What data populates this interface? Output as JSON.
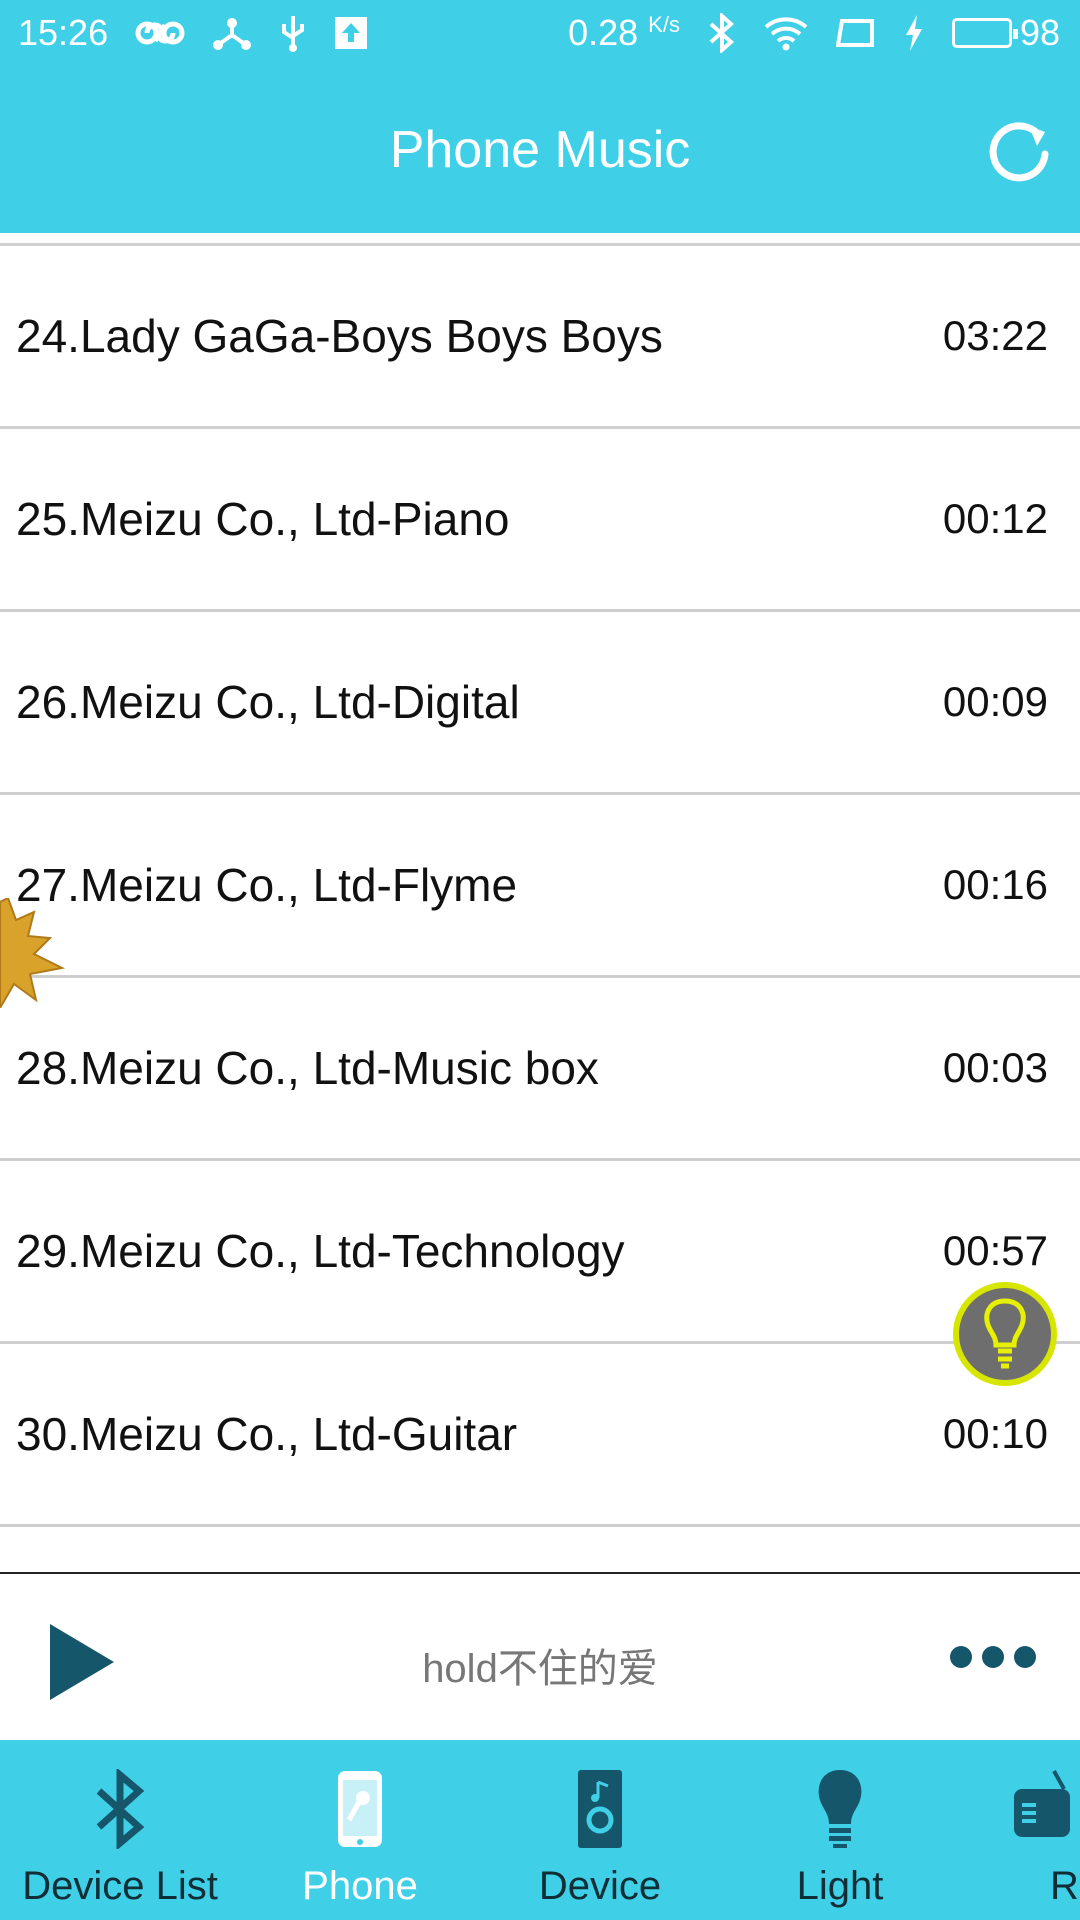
{
  "status_bar": {
    "time": "15:26",
    "speed": "0.28",
    "speed_unit": "K/s",
    "battery": "98",
    "battery_level": 0.98
  },
  "header": {
    "title": "Phone Music",
    "refresh_icon": "refresh-icon"
  },
  "songs": [
    {
      "name": "24.Lady GaGa-Boys Boys Boys",
      "duration": "03:22"
    },
    {
      "name": "25.Meizu Co., Ltd-Piano",
      "duration": "00:12"
    },
    {
      "name": "26.Meizu Co., Ltd-Digital",
      "duration": "00:09"
    },
    {
      "name": "27.Meizu Co., Ltd-Flyme",
      "duration": "00:16"
    },
    {
      "name": "28.Meizu Co., Ltd-Music box",
      "duration": "00:03"
    },
    {
      "name": "29.Meizu Co., Ltd-Technology",
      "duration": "00:57"
    },
    {
      "name": "30.Meizu Co., Ltd-Guitar",
      "duration": "00:10"
    }
  ],
  "player": {
    "now_playing": "hold不住的爱"
  },
  "nav": {
    "items": [
      {
        "label": "Device List",
        "icon": "bluetooth-icon"
      },
      {
        "label": "Phone",
        "icon": "phone-mic-icon",
        "active": true
      },
      {
        "label": "Device",
        "icon": "speaker-icon"
      },
      {
        "label": "Light",
        "icon": "bulb-icon"
      },
      {
        "label": "Ra",
        "icon": "radio-icon"
      }
    ]
  },
  "colors": {
    "accent": "#3fd0e8",
    "dark_icon": "#16566b",
    "divider": "#cfcfcf"
  }
}
